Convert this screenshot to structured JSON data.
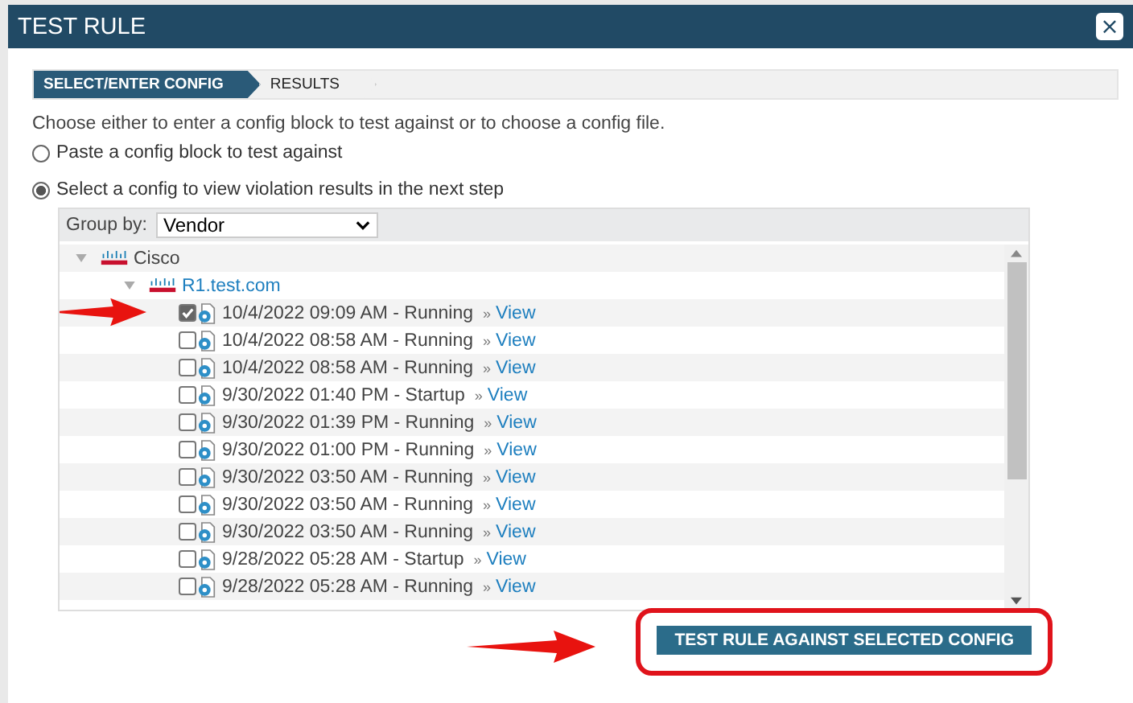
{
  "window": {
    "title": "TEST RULE",
    "close": "×"
  },
  "steps": [
    {
      "label": "SELECT/ENTER CONFIG",
      "selected": true
    },
    {
      "label": "RESULTS",
      "selected": false
    }
  ],
  "instructions": "Choose either to enter a config block to test against or to choose a config file.",
  "options": [
    {
      "label": "Paste a config block to test against",
      "selected": false
    },
    {
      "label": "Select a config to view violation results in the next step",
      "selected": true
    }
  ],
  "group_by": {
    "label": "Group by:",
    "value": "Vendor"
  },
  "tree": [
    {
      "label": "Cisco",
      "kind": "vendor",
      "expanded": true,
      "children": [
        {
          "label": "R1.test.com",
          "kind": "device",
          "expanded": true,
          "children": [
            {
              "label": "10/4/2022 09:09 AM - Running",
              "kind": "config",
              "checked": true,
              "link": "View"
            },
            {
              "label": "10/4/2022 08:58 AM - Running",
              "kind": "config",
              "checked": false,
              "link": "View"
            },
            {
              "label": "10/4/2022 08:58 AM - Running",
              "kind": "config",
              "checked": false,
              "link": "View"
            },
            {
              "label": "9/30/2022 01:40 PM - Startup",
              "kind": "config",
              "checked": false,
              "link": "View"
            },
            {
              "label": "9/30/2022 01:39 PM - Running",
              "kind": "config",
              "checked": false,
              "link": "View"
            },
            {
              "label": "9/30/2022 01:00 PM - Running",
              "kind": "config",
              "checked": false,
              "link": "View"
            },
            {
              "label": "9/30/2022 03:50 AM - Running",
              "kind": "config",
              "checked": false,
              "link": "View"
            },
            {
              "label": "9/30/2022 03:50 AM - Running",
              "kind": "config",
              "checked": false,
              "link": "View"
            },
            {
              "label": "9/30/2022 03:50 AM - Running",
              "kind": "config",
              "checked": false,
              "link": "View"
            },
            {
              "label": "9/28/2022 05:28 AM - Startup",
              "kind": "config",
              "checked": false,
              "link": "View"
            },
            {
              "label": "9/28/2022 05:28 AM - Running",
              "kind": "config",
              "checked": false,
              "link": "View"
            }
          ]
        }
      ]
    }
  ],
  "link_prefix": "»",
  "primary_button": {
    "label": "TEST RULE AGAINST SELECTED CONFIG",
    "highlighted": true
  }
}
